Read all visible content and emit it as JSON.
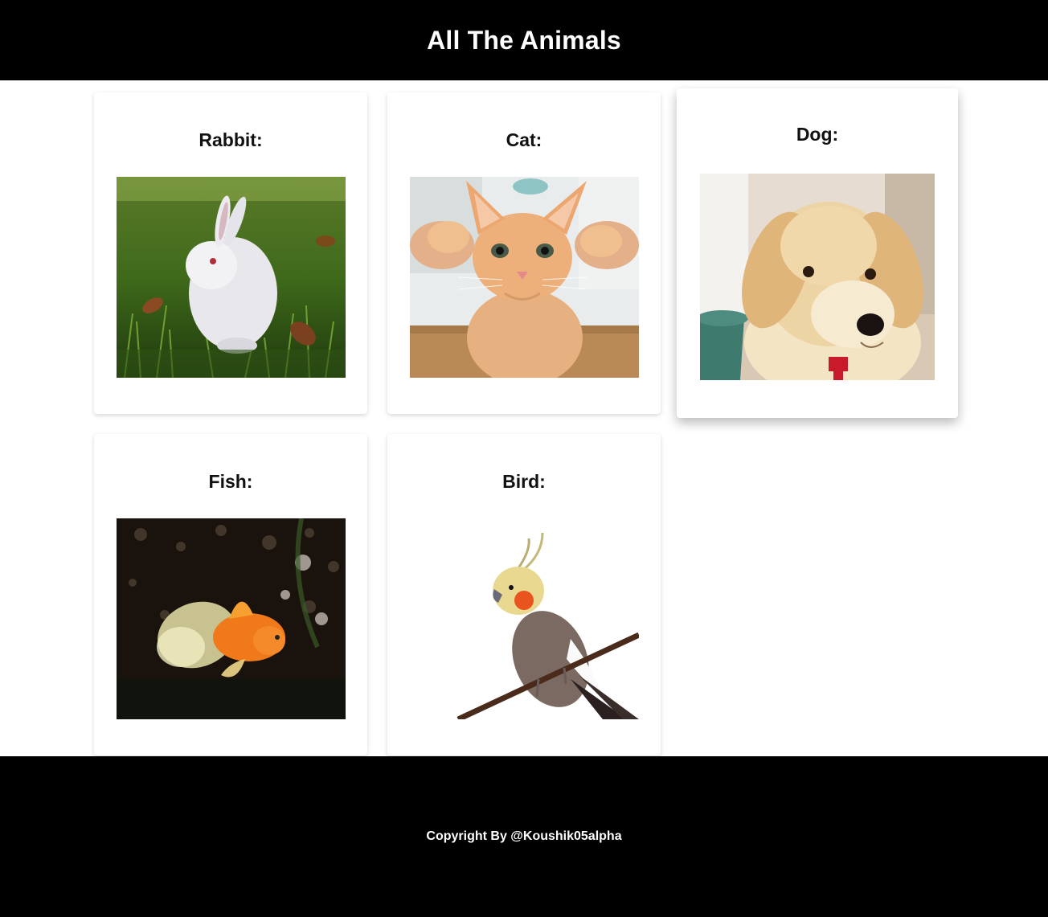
{
  "header": {
    "title": "All The Animals"
  },
  "cards": [
    {
      "title": "Rabbit:",
      "image": "rabbit-photo"
    },
    {
      "title": "Cat:",
      "image": "cat-photo"
    },
    {
      "title": "Dog:",
      "image": "dog-photo"
    },
    {
      "title": "Fish:",
      "image": "fish-photo"
    },
    {
      "title": "Bird:",
      "image": "bird-photo"
    }
  ],
  "footer": {
    "copyright": "Copyright By @Koushik05alpha"
  },
  "colors": {
    "header_bg": "#000000",
    "footer_bg": "#000000",
    "page_bg": "#ffffff",
    "header_text": "#ffffff"
  }
}
